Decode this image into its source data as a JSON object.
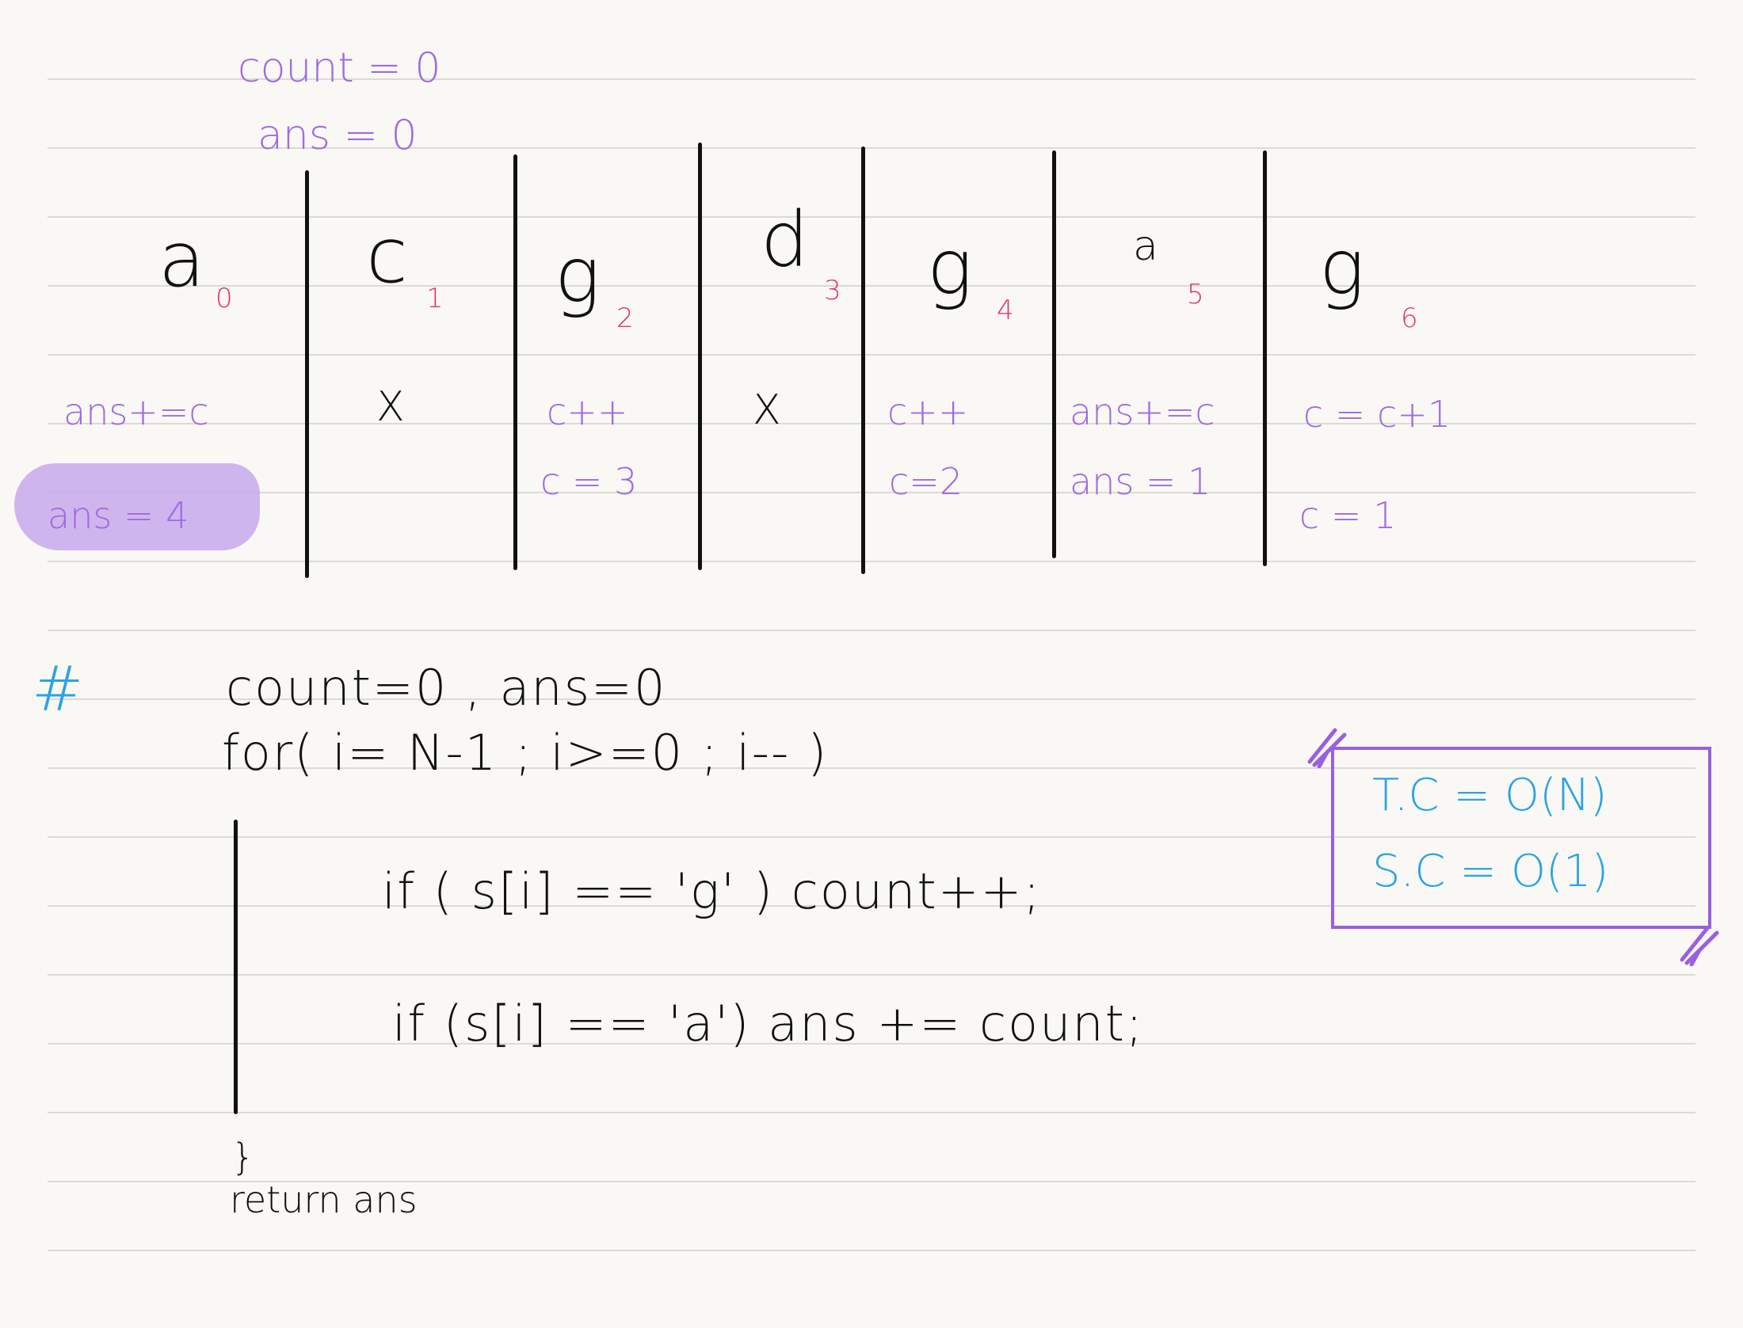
{
  "header": {
    "count_init": "count = 0",
    "ans_init": "ans  = 0"
  },
  "cells": [
    {
      "char": "a",
      "index": "0",
      "notes": [
        "ans+=c",
        "ans = 4"
      ]
    },
    {
      "char": "c",
      "index": "1",
      "notes": [
        "X"
      ]
    },
    {
      "char": "g",
      "index": "2",
      "notes": [
        "c++",
        "c = 3"
      ]
    },
    {
      "char": "d",
      "index": "3",
      "notes": [
        "X"
      ]
    },
    {
      "char": "g",
      "index": "4",
      "notes": [
        "c++",
        "c=2"
      ]
    },
    {
      "char": "a",
      "index": "5",
      "notes": [
        "ans+=c",
        "ans = 1"
      ]
    },
    {
      "char": "g",
      "index": "6",
      "notes": [
        "c = c+1",
        "c = 1"
      ]
    }
  ],
  "code": {
    "hash": "#",
    "line1": "count=0    ,   ans=0",
    "line2": "for( i= N-1  ;  i>=0  ;  i-- )",
    "line3": "if ( s[i] == 'g' )  count++;",
    "line4": "if  (s[i] == 'a')  ans += count;",
    "line5": "}",
    "line6": "return ans"
  },
  "complexity": {
    "tc": "T.C = O(N)",
    "sc": "S.C = O(1)"
  },
  "colors": {
    "purple": "#a06ae0",
    "pink": "#e0346a",
    "blue": "#2aa3e3",
    "rule": "#d9d7d2",
    "paper": "#f9f8f4"
  }
}
